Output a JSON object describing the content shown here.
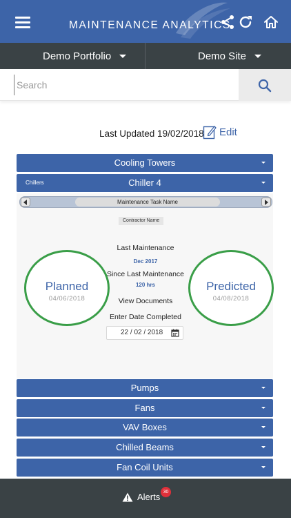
{
  "header": {
    "title": "MAINTENANCE ANALYTICS",
    "menu_icon": "hamburger-menu-icon",
    "share_icon": "share-icon",
    "refresh_icon": "refresh-icon",
    "home_icon": "home-icon"
  },
  "selectors": {
    "portfolio": "Demo Portfolio",
    "site": "Demo Site"
  },
  "search": {
    "placeholder": "Search",
    "value": "",
    "icon": "search-icon"
  },
  "status": {
    "last_updated": "Last Updated 19/02/2018",
    "edit_label": "Edit"
  },
  "sections": {
    "cooling_towers": "Cooling Towers",
    "pumps": "Pumps",
    "fans": "Fans",
    "vav_boxes": "VAV Boxes",
    "chilled_beams": "Chilled Beams",
    "fan_coil_units": "Fan Coil Units"
  },
  "chiller": {
    "category": "Chillers",
    "name": "Chiller 4",
    "task_name": "Maintenance Task Name",
    "contractor": "Contractor Name",
    "planned_label": "Planned",
    "planned_date": "04/06/2018",
    "predicted_label": "Predicted",
    "predicted_date": "04/08/2018",
    "last_maintenance_label": "Last Maintenance",
    "last_maintenance_value": "Dec 2017",
    "since_label": "Since Last Maintenance",
    "since_value": "120 hrs",
    "view_documents": "View Documents",
    "enter_date_label": "Enter Date Completed",
    "date_completed": "22 / 02 / 2018"
  },
  "alerts": {
    "label": "Alerts",
    "count": "30"
  },
  "colors": {
    "primary": "#3d64a8",
    "dark_bar": "#3a4245",
    "ring_green": "#3a9e48",
    "badge_red": "#e0303a"
  }
}
